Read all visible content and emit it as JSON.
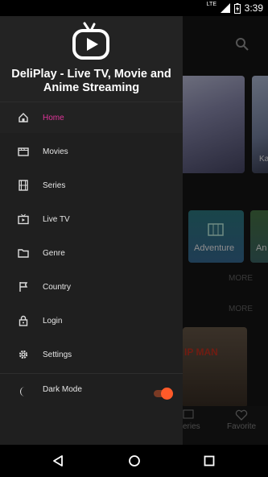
{
  "status_bar": {
    "network": "LTE",
    "time": "3:39"
  },
  "app": {
    "title": "DeliPlay - Live TV, Movie and Anime Streaming",
    "logo_icon": "tv-play-logo-icon"
  },
  "drawer": {
    "items": [
      {
        "label": "Home",
        "icon": "home-icon",
        "active": true
      },
      {
        "label": "Movies",
        "icon": "movie-icon",
        "active": false
      },
      {
        "label": "Series",
        "icon": "film-strip-icon",
        "active": false
      },
      {
        "label": "Live TV",
        "icon": "live-tv-icon",
        "active": false
      },
      {
        "label": "Genre",
        "icon": "folder-icon",
        "active": false
      },
      {
        "label": "Country",
        "icon": "flag-icon",
        "active": false
      },
      {
        "label": "Login",
        "icon": "lock-icon",
        "active": false
      },
      {
        "label": "Settings",
        "icon": "gear-icon",
        "active": false
      }
    ],
    "dark_mode": {
      "label": "Dark Mode",
      "enabled": true
    }
  },
  "background": {
    "poster_caption_partial": "Ka",
    "genre_card": "Adventure",
    "genre_card_partial": "An",
    "more_1": "MORE",
    "more_2": "MORE",
    "poster_text": "IP MAN",
    "bottom_nav": {
      "series_partial": "eries",
      "favorite": "Favorite"
    }
  },
  "colors": {
    "accent": "#e0349a",
    "toggle": "#ff5a29",
    "drawer_bg": "#1f1f1f"
  }
}
